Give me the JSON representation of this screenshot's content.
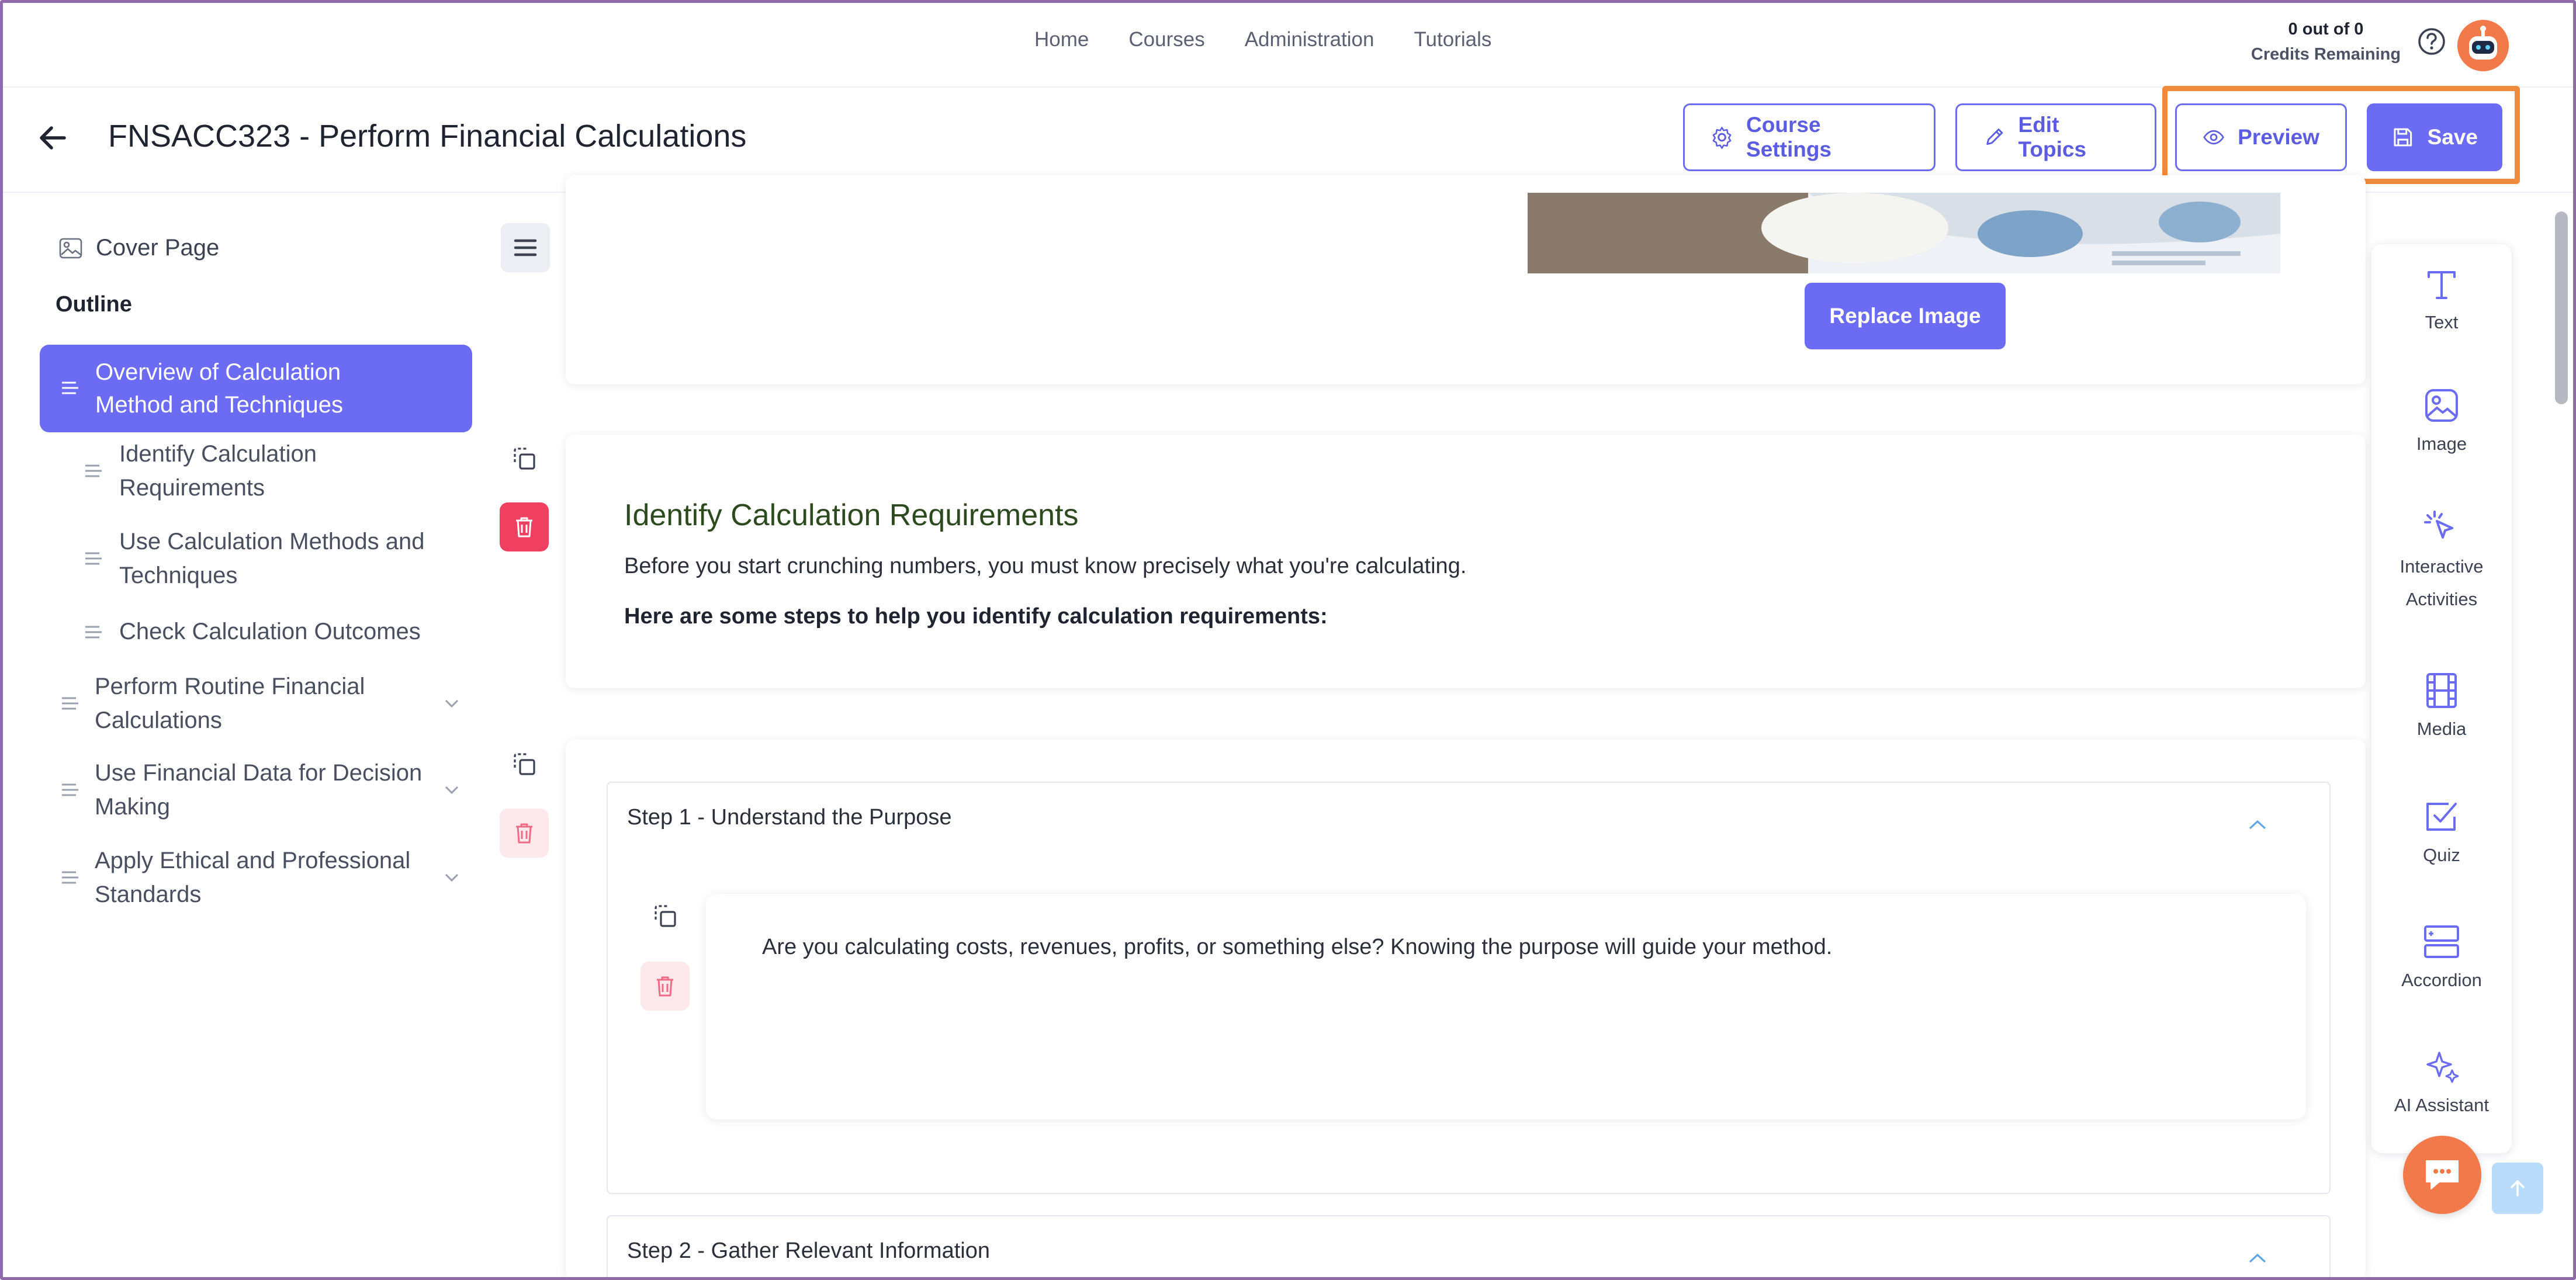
{
  "topnav": {
    "items": [
      "Home",
      "Courses",
      "Administration",
      "Tutorials"
    ],
    "credits_count": "0 out of 0",
    "credits_label": "Credits Remaining"
  },
  "course": {
    "title": "FNSACC323 - Perform Financial Calculations",
    "settings_label": "Course Settings",
    "edit_topics_label": "Edit Topics",
    "preview_label": "Preview",
    "save_label": "Save"
  },
  "sidebar": {
    "cover_label": "Cover Page",
    "outline_label": "Outline",
    "active_item": "Overview of Calculation Method and Techniques",
    "items": [
      "Identify Calculation Requirements",
      "Use Calculation Methods and Techniques",
      "Check Calculation Outcomes",
      "Perform Routine Financial Calculations",
      "Use Financial Data for Decision Making",
      "Apply Ethical and Professional Standards"
    ]
  },
  "content": {
    "replace_image_label": "Replace Image",
    "section_heading": "Identify Calculation Requirements",
    "section_intro": "Before you start crunching numbers, you must know precisely what you're calculating.",
    "section_bold": "Here are some steps to help you identify calculation requirements:",
    "step1_title": "Step 1 - Understand the Purpose",
    "step1_body": "Are you calculating costs, revenues, profits, or something else? Knowing the purpose will guide your method.",
    "step2_title": "Step 2 - Gather Relevant Information"
  },
  "tools": {
    "items": [
      "Text",
      "Image",
      "Interactive",
      "Activities",
      "Media",
      "Quiz",
      "Accordion",
      "AI Assistant"
    ]
  },
  "colors": {
    "accent": "#6b6bf3",
    "highlight": "#f08a3c",
    "danger": "#ef4061",
    "heading_green": "#2d4a1f"
  }
}
